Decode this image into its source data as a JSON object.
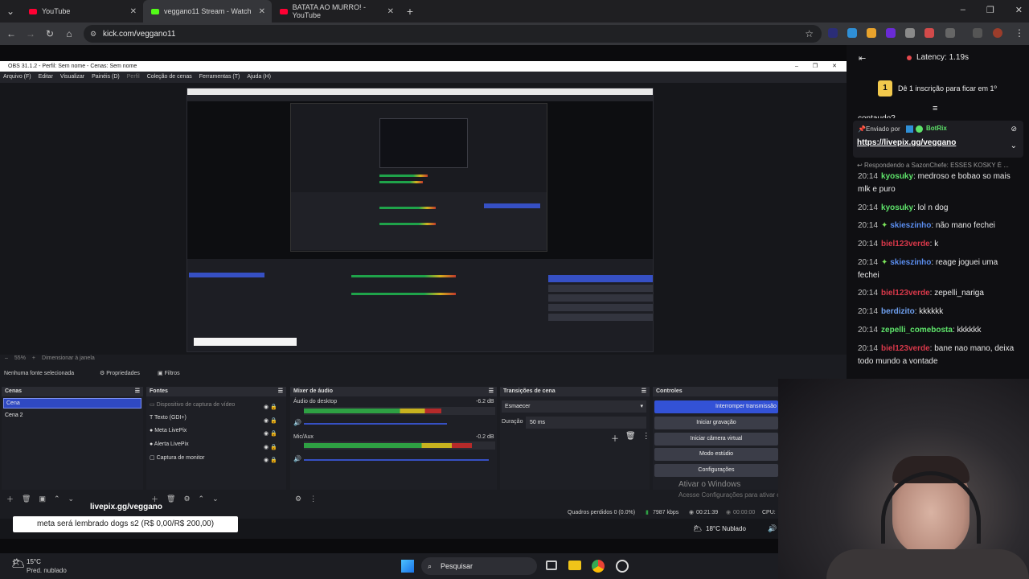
{
  "browser": {
    "tabs": [
      {
        "title": "YouTube",
        "color": "#ff0033"
      },
      {
        "title": "veggano11 Stream - Watch",
        "color": "#53fc18"
      },
      {
        "title": "BATATA AO MURRO! - YouTube",
        "color": "#ff0033"
      }
    ],
    "url": "kick.com/veggano11"
  },
  "obs": {
    "title": "OBS 31.1.2 - Perfil: Sem nome - Cenas: Sem nome",
    "menu": [
      "Arquivo (F)",
      "Editar",
      "Visualizar",
      "Painéis (D)",
      "Perfil",
      "Coleção de cenas",
      "Ferramentas (T)",
      "Ajuda (H)"
    ],
    "zoom": "55%",
    "resize_label": "Dimensionar à janela",
    "no_source": "Nenhuma fonte selecionada",
    "properties": "Propriedades",
    "filters": "Filtros",
    "docks": {
      "scenes": {
        "title": "Cenas",
        "items": [
          "Cena",
          "Cena 2"
        ]
      },
      "sources": {
        "title": "Fontes",
        "items": [
          "Dispositivo de captura de vídeo",
          "Texto (GDI+)",
          "Meta LivePix",
          "Alerta LivePix",
          "Captura de monitor"
        ]
      },
      "mixer": {
        "title": "Mixer de áudio",
        "channels": [
          {
            "name": "Áudio do desktop",
            "db": "-6.2 dB",
            "level": 0.72
          },
          {
            "name": "Mic/Aux",
            "db": "-0.2 dB",
            "level": 0.88
          }
        ],
        "scale": [
          "-60",
          "-55",
          "-50",
          "-45",
          "-40",
          "-35",
          "-30",
          "-25",
          "-20",
          "-15",
          "-10",
          "-5",
          "0"
        ]
      },
      "transitions": {
        "title": "Transições de cena",
        "type": "Esmaecer",
        "duration_label": "Duração",
        "duration": "50 ms"
      },
      "controls": {
        "title": "Controles",
        "buttons": [
          "Interromper transmissão",
          "Iniciar gravação",
          "Iniciar câmera virtual",
          "Modo estúdio",
          "Configurações"
        ]
      }
    },
    "status": {
      "frames": "Quadros perdidos 0 (0.0%)",
      "bitrate": "7987 kbps",
      "time1": "00:21:39",
      "time2": "00:00:00",
      "cpu": "CPU: 1"
    },
    "activate": {
      "title": "Ativar o Windows",
      "sub": "Acesse Configurações para ativar o Windows."
    }
  },
  "overlay": {
    "livepix": "livepix.gg/veggano",
    "goal": "meta será lembrado dogs s2 (R$ 0,00/R$ 200,00)"
  },
  "chat": {
    "latency": "Latency: 1.19s",
    "sub_prompt": "Dê 1 inscrição para ficar em 1º",
    "cutoff": "contaudo?",
    "pinned": {
      "by_label": "Enviado por",
      "bot": "BotRix",
      "link": "https://livepix.gg/veggano"
    },
    "reply": "Respondendo a SazonChefe: ESSES KOSKY É ...",
    "messages": [
      {
        "time": "20:14",
        "user": "kyosuky",
        "text": "medroso e bobao so mais mlk e puro",
        "color": "green"
      },
      {
        "time": "20:14",
        "user": "kyosuky",
        "text": "lol n dog",
        "color": "green"
      },
      {
        "time": "20:14",
        "user": "skieszinho",
        "text": "não mano fechei",
        "color": "blue"
      },
      {
        "time": "20:14",
        "user": "biel123verde",
        "text": "k",
        "color": "red"
      },
      {
        "time": "20:14",
        "user": "skieszinho",
        "text": "reage joguei uma fechei",
        "color": "blue"
      },
      {
        "time": "20:14",
        "user": "biel123verde",
        "text": "zepelli_nariga",
        "color": "red"
      },
      {
        "time": "20:14",
        "user": "berdizito",
        "text": "kkkkkk",
        "color": "lblue"
      },
      {
        "time": "20:14",
        "user": "zepelli_comebosta",
        "text": "kkkkkk",
        "color": "green"
      },
      {
        "time": "20:14",
        "user": "biel123verde",
        "text": "bane nao mano, deixa todo mundo a vontade",
        "color": "red"
      }
    ]
  },
  "taskbar": {
    "weather_temp": "15°C",
    "weather_desc": "Pred. nublado",
    "search": "Pesquisar",
    "tray_weather": "18°C Nublado"
  }
}
